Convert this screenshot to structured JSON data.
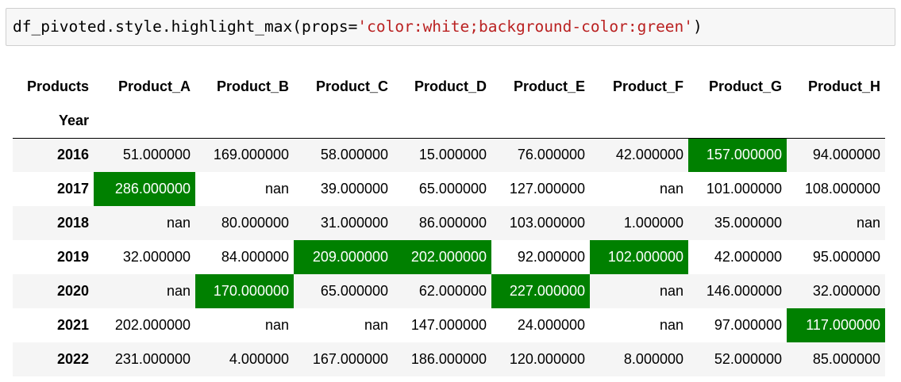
{
  "code_cell": {
    "prefix": "df_pivoted.style.highlight_max(props=",
    "string_arg": "'color:white;background-color:green'",
    "suffix": ")"
  },
  "table": {
    "columns_name": "Products",
    "index_name": "Year",
    "columns": [
      "Product_A",
      "Product_B",
      "Product_C",
      "Product_D",
      "Product_E",
      "Product_F",
      "Product_G",
      "Product_H"
    ],
    "rows": [
      {
        "index": "2016",
        "cells": [
          {
            "value": "51.000000",
            "max": false
          },
          {
            "value": "169.000000",
            "max": false
          },
          {
            "value": "58.000000",
            "max": false
          },
          {
            "value": "15.000000",
            "max": false
          },
          {
            "value": "76.000000",
            "max": false
          },
          {
            "value": "42.000000",
            "max": false
          },
          {
            "value": "157.000000",
            "max": true
          },
          {
            "value": "94.000000",
            "max": false
          }
        ]
      },
      {
        "index": "2017",
        "cells": [
          {
            "value": "286.000000",
            "max": true
          },
          {
            "value": "nan",
            "max": false
          },
          {
            "value": "39.000000",
            "max": false
          },
          {
            "value": "65.000000",
            "max": false
          },
          {
            "value": "127.000000",
            "max": false
          },
          {
            "value": "nan",
            "max": false
          },
          {
            "value": "101.000000",
            "max": false
          },
          {
            "value": "108.000000",
            "max": false
          }
        ]
      },
      {
        "index": "2018",
        "cells": [
          {
            "value": "nan",
            "max": false
          },
          {
            "value": "80.000000",
            "max": false
          },
          {
            "value": "31.000000",
            "max": false
          },
          {
            "value": "86.000000",
            "max": false
          },
          {
            "value": "103.000000",
            "max": false
          },
          {
            "value": "1.000000",
            "max": false
          },
          {
            "value": "35.000000",
            "max": false
          },
          {
            "value": "nan",
            "max": false
          }
        ]
      },
      {
        "index": "2019",
        "cells": [
          {
            "value": "32.000000",
            "max": false
          },
          {
            "value": "84.000000",
            "max": false
          },
          {
            "value": "209.000000",
            "max": true
          },
          {
            "value": "202.000000",
            "max": true
          },
          {
            "value": "92.000000",
            "max": false
          },
          {
            "value": "102.000000",
            "max": true
          },
          {
            "value": "42.000000",
            "max": false
          },
          {
            "value": "95.000000",
            "max": false
          }
        ]
      },
      {
        "index": "2020",
        "cells": [
          {
            "value": "nan",
            "max": false
          },
          {
            "value": "170.000000",
            "max": true
          },
          {
            "value": "65.000000",
            "max": false
          },
          {
            "value": "62.000000",
            "max": false
          },
          {
            "value": "227.000000",
            "max": true
          },
          {
            "value": "nan",
            "max": false
          },
          {
            "value": "146.000000",
            "max": false
          },
          {
            "value": "32.000000",
            "max": false
          }
        ]
      },
      {
        "index": "2021",
        "cells": [
          {
            "value": "202.000000",
            "max": false
          },
          {
            "value": "nan",
            "max": false
          },
          {
            "value": "nan",
            "max": false
          },
          {
            "value": "147.000000",
            "max": false
          },
          {
            "value": "24.000000",
            "max": false
          },
          {
            "value": "nan",
            "max": false
          },
          {
            "value": "97.000000",
            "max": false
          },
          {
            "value": "117.000000",
            "max": true
          }
        ]
      },
      {
        "index": "2022",
        "cells": [
          {
            "value": "231.000000",
            "max": false
          },
          {
            "value": "4.000000",
            "max": false
          },
          {
            "value": "167.000000",
            "max": false
          },
          {
            "value": "186.000000",
            "max": false
          },
          {
            "value": "120.000000",
            "max": false
          },
          {
            "value": "8.000000",
            "max": false
          },
          {
            "value": "52.000000",
            "max": false
          },
          {
            "value": "85.000000",
            "max": false
          }
        ]
      }
    ]
  },
  "colors": {
    "highlight_background": "#008000",
    "highlight_text": "#ffffff",
    "code_string": "#ba2121",
    "stripe": "#f5f5f5"
  }
}
